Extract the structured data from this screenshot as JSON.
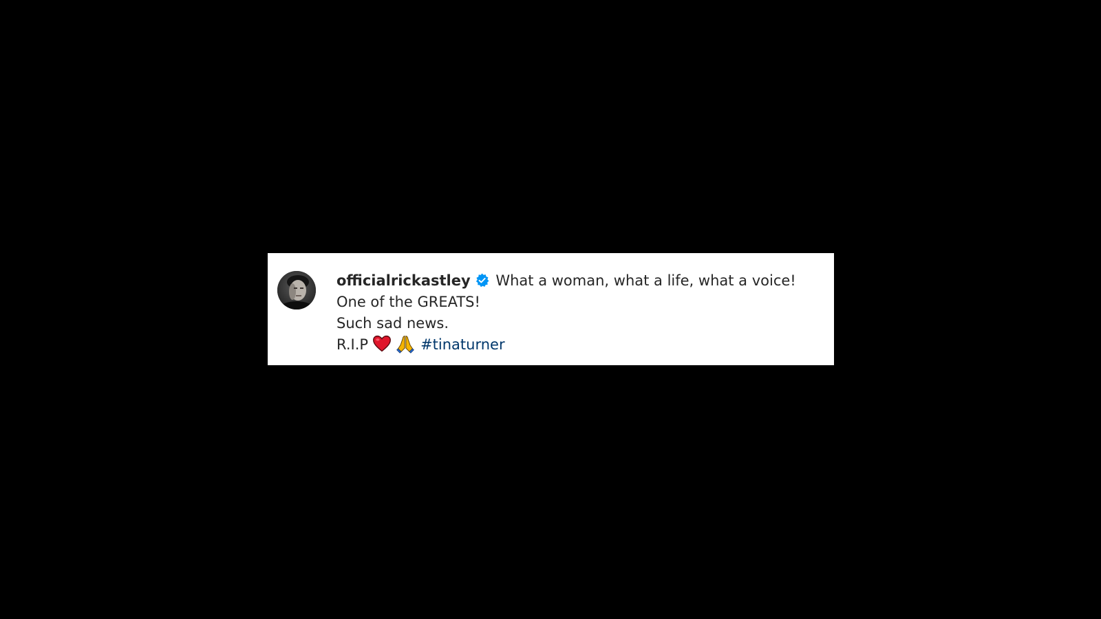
{
  "comment": {
    "username": "officialrickastley",
    "verified_icon": "verified-badge-icon",
    "text_line1": "What a woman, what a life, what a voice! One of the GREATS!",
    "text_line2": "Such sad news.",
    "text_line3": "R.I.P",
    "emojis": [
      "red-heart-icon",
      "folded-hands-icon"
    ],
    "hashtag": "#tinaturner"
  },
  "colors": {
    "background": "#000000",
    "card": "#ffffff",
    "text": "#262626",
    "verified_badge": "#0095f6",
    "hashtag": "#00376b",
    "heart": "#e0162b",
    "hands": "#f5b400"
  }
}
